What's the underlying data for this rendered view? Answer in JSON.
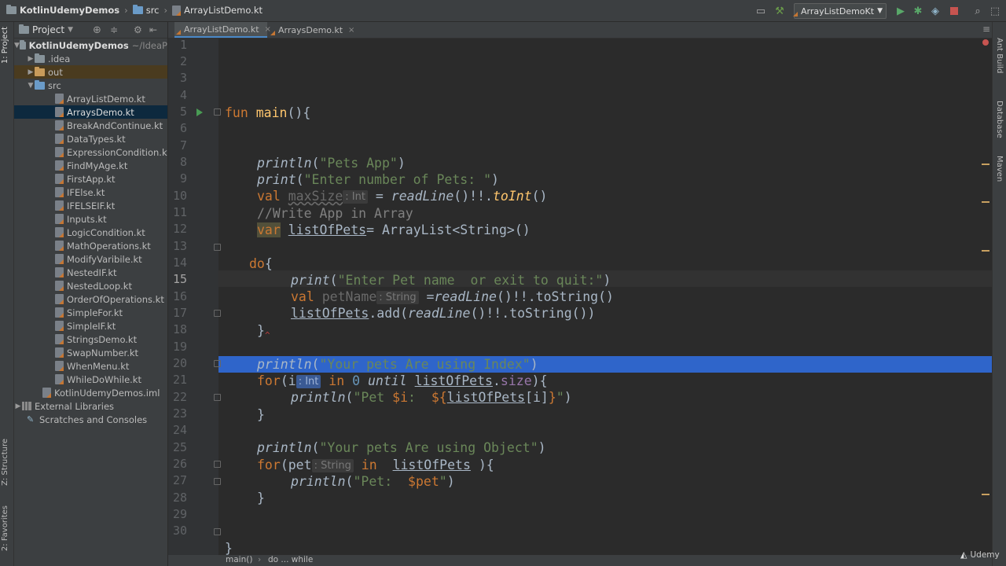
{
  "breadcrumb": {
    "project": "KotlinUdemyDemos",
    "folder": "src",
    "file": "ArrayListDemo.kt"
  },
  "toolbar": {
    "run_config": "ArrayListDemoKt"
  },
  "left_tabs": {
    "project": "1: Project",
    "structure": "Z: Structure",
    "favorites": "2: Favorites"
  },
  "right_tabs": {
    "ant": "Ant Build",
    "database": "Database",
    "maven": "Maven"
  },
  "project_panel": {
    "title": "Project",
    "root": "KotlinUdemyDemos",
    "root_path": "~/IdeaP",
    "items": [
      {
        "label": ".idea"
      },
      {
        "label": "out"
      },
      {
        "label": "src"
      },
      {
        "label": "ArrayListDemo.kt"
      },
      {
        "label": "ArraysDemo.kt"
      },
      {
        "label": "BreakAndContinue.kt"
      },
      {
        "label": "DataTypes.kt"
      },
      {
        "label": "ExpressionCondition.kt"
      },
      {
        "label": "FindMyAge.kt"
      },
      {
        "label": "FirstApp.kt"
      },
      {
        "label": "IFElse.kt"
      },
      {
        "label": "IFELSEIF.kt"
      },
      {
        "label": "Inputs.kt"
      },
      {
        "label": "LogicCondition.kt"
      },
      {
        "label": "MathOperations.kt"
      },
      {
        "label": "ModifyVaribile.kt"
      },
      {
        "label": "NestedIF.kt"
      },
      {
        "label": "NestedLoop.kt"
      },
      {
        "label": "OrderOfOperations.kt"
      },
      {
        "label": "SimpleFor.kt"
      },
      {
        "label": "SimpleIF.kt"
      },
      {
        "label": "StringsDemo.kt"
      },
      {
        "label": "SwapNumber.kt"
      },
      {
        "label": "WhenMenu.kt"
      },
      {
        "label": "WhileDoWhile.kt"
      },
      {
        "label": "KotlinUdemyDemos.iml"
      },
      {
        "label": "External Libraries"
      },
      {
        "label": "Scratches and Consoles"
      }
    ]
  },
  "editor_tabs": [
    {
      "label": "ArrayListDemo.kt"
    },
    {
      "label": "ArraysDemo.kt"
    }
  ],
  "line_numbers": [
    "1",
    "2",
    "3",
    "4",
    "5",
    "6",
    "7",
    "8",
    "9",
    "10",
    "11",
    "12",
    "13",
    "14",
    "15",
    "16",
    "17",
    "18",
    "19",
    "20",
    "21",
    "22",
    "23",
    "24",
    "25",
    "26",
    "27",
    "28",
    "29",
    "30"
  ],
  "code": {
    "l5_fun": "fun ",
    "l5_main": "main",
    "l5_rest": "(){",
    "l7_fn": "println",
    "l7_a": "(",
    "l7_str": "\"Pets App\"",
    "l7_b": ")",
    "l8_fn": "print",
    "l8_a": "(",
    "l8_str": "\"Enter number of Pets: \"",
    "l8_b": ")",
    "l9_val": "val ",
    "l9_name": "maxSize",
    "l9_hint": ": Int",
    "l9_eq": " = ",
    "l9_fn": "readLine",
    "l9_mid": "()!!.",
    "l9_toint": "toInt",
    "l9_end": "()",
    "l10_cmt": "//Write App in Array",
    "l11_var": "var",
    "l11_sp": " ",
    "l11_name": "listOfPets",
    "l11_rest": "= ArrayList<String>()",
    "l13_do": "do",
    "l13_brace": "{",
    "l14_fn": "print",
    "l14_a": "(",
    "l14_str": "\"Enter Pet name  or exit to quit:\"",
    "l14_b": ")",
    "l15_val": "val ",
    "l15_name": "petName",
    "l15_hint": ": String",
    "l15_eq": " =",
    "l15_fn": "readLine",
    "l15_rest": "()!!.toString()",
    "l16_name": "listOfPets",
    "l16_a": ".add(",
    "l16_fn": "readLine",
    "l16_rest": "()!!.toString())",
    "l17_brace": "}",
    "l19_fn": "println",
    "l19_a": "(",
    "l19_str": "\"Your pets Are using Index\"",
    "l19_b": ")",
    "l20_for": "for",
    "l20_a": "(i",
    "l20_hint": ": Int",
    "l20_in": " in ",
    "l20_zero": "0",
    "l20_sp": " ",
    "l20_until": "until",
    "l20_sp2": " ",
    "l20_list": "listOfPets",
    "l20_dot": ".",
    "l20_size": "size",
    "l20_end": "){",
    "l21_fn": "println",
    "l21_a": "(",
    "l21_str1": "\"Pet ",
    "l21_i": "$i",
    "l21_str2": ":  ",
    "l21_tpl1": "${",
    "l21_list": "listOfPets",
    "l21_idx": "[i]",
    "l21_tpl2": "}",
    "l21_str3": "\"",
    "l21_b": ")",
    "l22_brace": "}",
    "l24_fn": "println",
    "l24_a": "(",
    "l24_str": "\"Your pets Are using Object\"",
    "l24_b": ")",
    "l25_for": "for",
    "l25_a": "(pet",
    "l25_hint": ": String",
    "l25_in": " in ",
    "l25_sp": " ",
    "l25_list": "listOfPets",
    "l25_end": " ){",
    "l26_fn": "println",
    "l26_a": "(",
    "l26_str1": "\"Pet:  ",
    "l26_var": "$pet",
    "l26_str2": "\"",
    "l26_b": ")",
    "l27_brace": "}",
    "l30_brace": "}"
  },
  "status_breadcrumb": {
    "fn": "main()",
    "block": "do ... while"
  },
  "watermark": "Udemy",
  "colors": {
    "keyword": "#cc7832",
    "function": "#ffc66d",
    "string": "#6a8759",
    "comment": "#808080",
    "selection": "#2f65ca",
    "property": "#9876aa"
  }
}
